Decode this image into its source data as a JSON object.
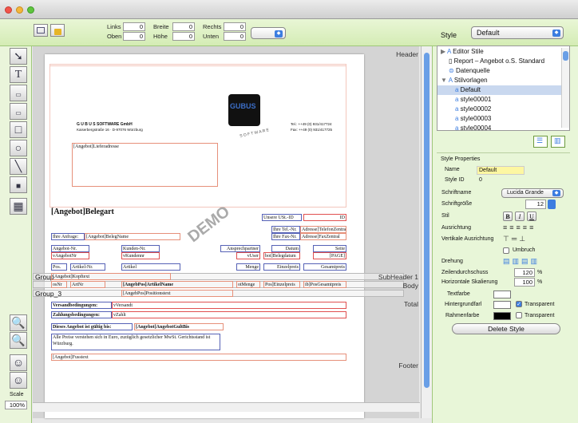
{
  "toolbar": {
    "links_label": "Links",
    "links_value": "0",
    "oben_label": "Oben",
    "oben_value": "0",
    "breite_label": "Breite",
    "breite_value": "0",
    "hoehe_label": "Höhe",
    "hoehe_value": "0",
    "rechts_label": "Rechts",
    "rechts_value": "0",
    "unten_label": "Unten",
    "unten_value": "0",
    "style_label": "Style",
    "style_value": "Default"
  },
  "scale": {
    "label": "Scale",
    "value": "100%"
  },
  "sections": {
    "header": "Header",
    "subheader": "SubHeader 1",
    "body": "Body",
    "total": "Total",
    "footer": "Footer",
    "group": "Group",
    "group3": "Group_3"
  },
  "page": {
    "company": "G U B U S SOFTWARE GmbH",
    "address": "Kaiserbergstraße 16 · D-97076 Würzburg",
    "tel": "Tel.: ++49 (0) 931/417724",
    "fax": "Fax: ++49 (0) 931/417725",
    "logo": "GUBUS",
    "software": "S O F T W A R E",
    "lieferadresse": "[Angebot]Lieferadresse",
    "belegart": "[Angebot]Belegart",
    "demo": "DEMO",
    "unsere_ust": "Unsere USt.-ID",
    "id": "ID",
    "ihre_tel": "Ihre Tel.-Nr.",
    "tel_adr": "Adresse]TelefonZentral",
    "ihre_fax": "Ihre Fax-Nr.",
    "fax_adr": "Adresse]FaxZentral",
    "ihre_anfrage": "Ihre Anfrage:",
    "belegname": "[Angebot]BelegName",
    "angebotnr_lbl": "Angebot-Nr.",
    "kundennr_lbl": "Kunden-Nr.",
    "ansprech_lbl": "Ansprechpartner",
    "datum_lbl": "Datum",
    "seite_lbl": "Seite",
    "angebotnr": "vAngebotNr",
    "kundennr": "vKundennr",
    "vuser": "vUser",
    "belegdatum": "bot]Belegdatum",
    "pagenum": "[PAGE]",
    "pos": "Pos.",
    "artikelnr": "Artikel-Nr.",
    "artikel": "Artikel",
    "menge": "Menge",
    "einzelpreis": "Einzelpreis",
    "gesamtpreis": "Gesamtpreis",
    "kopftext": "[Angebot]Kopftext",
    "posnr": "osNr",
    "artnr": "ArtNr",
    "artikelname": "[AngebPos]ArtikelName",
    "postmenge": "otMenge",
    "poseinzel": "Pos]Einzelpreis",
    "posgesamt": "ib]PosGesamtpreis",
    "positionstext": "[AngebPos]Positionstext",
    "versand_lbl": "Versandbedingungen:",
    "versand": "vVersandt",
    "zahlung_lbl": "Zahlungsbedingungen:",
    "zahlung": "vZahlt",
    "gueltig_lbl": "Dieses Angebot ist gültig bis:",
    "gueltig": "[Angebot]AngebotGultBis",
    "hinweis": "Alle Preise verstehen sich in Euro, zuzüglich gesetzlicher MwSt. Gerichtsstand ist Würzburg.",
    "fusstext": "[Angebot]Fusstext"
  },
  "tree": {
    "items": [
      "Editor Stile",
      "Report – Angebot o.S. Standard",
      "Datenquelle",
      "Stilvorlagen",
      "Default",
      "style00001",
      "style00002",
      "style00003",
      "style00004"
    ]
  },
  "props": {
    "title": "Style Properties",
    "name_lbl": "Name",
    "name_val": "Default",
    "id_lbl": "Style ID",
    "id_val": "0",
    "schriftname_lbl": "Schriftname",
    "schriftname": "Lucida Grande",
    "groesse_lbl": "Schriftgröße",
    "groesse": "12",
    "stil_lbl": "Stil",
    "bold": "B",
    "italic": "I",
    "underline": "U",
    "ausrichtung_lbl": "Ausrichtung",
    "vert_lbl": "Vertikale Ausrichtung",
    "umbruch": "Umbruch",
    "drehung_lbl": "Drehung",
    "zeilen_lbl": "Zeilendurchschuss",
    "zeilen_val": "120",
    "zeilen_unit": "%",
    "hskal_lbl": "Horizontale Skalierung",
    "hskal_val": "100",
    "hskal_unit": "%",
    "textfarbe": "Textfarbe",
    "hintergrund": "Hintergrundfarl",
    "transparent1": "Transparent",
    "rahmen": "Rahmenfarbe",
    "transparent2": "Transparent",
    "delete": "Delete Style"
  },
  "colors": {
    "accent": "#3c7de0",
    "panel": "#e8f6d8",
    "orange": "#e6907a",
    "blue": "#5662b6",
    "red": "#e05050"
  }
}
